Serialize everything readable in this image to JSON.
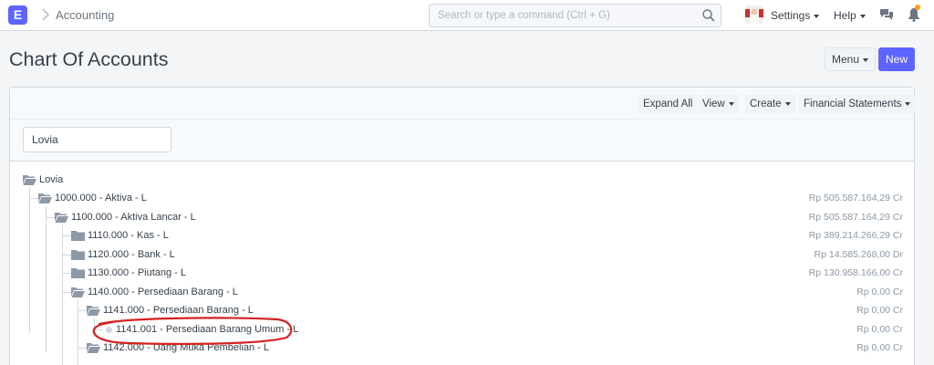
{
  "navbar": {
    "logo_letter": "E",
    "breadcrumb": "Accounting",
    "search_placeholder": "Search or type a command (Ctrl + G)",
    "settings_label": "Settings",
    "help_label": "Help"
  },
  "page": {
    "title": "Chart Of Accounts",
    "menu_label": "Menu",
    "new_label": "New"
  },
  "toolbar": {
    "expand_all": "Expand All",
    "view": "View",
    "create": "Create",
    "financial_statements": "Financial Statements"
  },
  "filter": {
    "company_value": "Lovia"
  },
  "tree": {
    "root": "Lovia",
    "nodes": [
      {
        "label": "1000.000 - Aktiva - L",
        "balance": "Rp 505.587.164,29 Cr"
      },
      {
        "label": "1100.000 - Aktiva Lancar - L",
        "balance": "Rp 505.587.164,29 Cr"
      },
      {
        "label": "1110.000 - Kas - L",
        "balance": "Rp 389.214.266,29 Cr"
      },
      {
        "label": "1120.000 - Bank - L",
        "balance": "Rp 14.585.268,00 Dr"
      },
      {
        "label": "1130.000 - Piutang - L",
        "balance": "Rp 130.958.166,00 Cr"
      },
      {
        "label": "1140.000 - Persediaan Barang - L",
        "balance": "Rp 0,00 Cr"
      },
      {
        "label": "1141.000 - Persediaan Barang - L",
        "balance": "Rp 0,00 Cr"
      },
      {
        "label": "1141.001 - Persediaan Barang Umum - L",
        "balance": "Rp 0,00 Cr"
      },
      {
        "label": "1142.000 - Uang Muka Pembelian - L",
        "balance": "Rp 0,00 Cr"
      }
    ]
  },
  "colors": {
    "primary": "#5e64ff",
    "annotation": "#d62020",
    "notification": "#ffa00a"
  }
}
